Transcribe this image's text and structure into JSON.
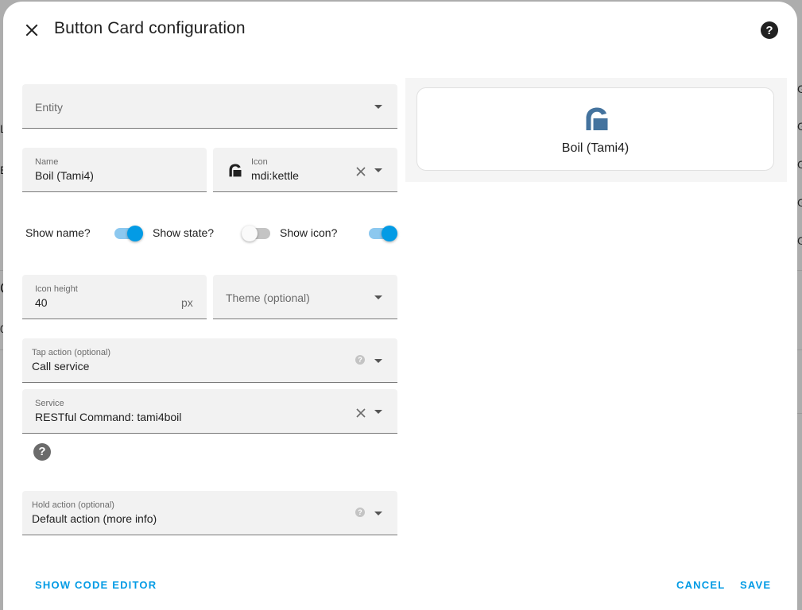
{
  "background": {
    "fragments": [
      "L",
      "E",
      "C",
      "0",
      "G",
      "G",
      "G",
      "G",
      "G"
    ]
  },
  "dialog": {
    "title": "Button Card configuration",
    "close_icon": "close-icon",
    "help_icon": "help-circle-icon"
  },
  "form": {
    "entity": {
      "label": "Entity"
    },
    "name": {
      "label": "Name",
      "value": "Boil (Tami4)"
    },
    "icon": {
      "label": "Icon",
      "value": "mdi:kettle",
      "glyph": "kettle-icon"
    },
    "toggles": {
      "show_name": {
        "label": "Show name?",
        "on": true
      },
      "show_state": {
        "label": "Show state?",
        "on": false
      },
      "show_icon": {
        "label": "Show icon?",
        "on": true
      }
    },
    "icon_height": {
      "label": "Icon height",
      "value": "40",
      "unit": "px"
    },
    "theme": {
      "label": "Theme (optional)"
    },
    "tap_action": {
      "label": "Tap action (optional)",
      "value": "Call service"
    },
    "service": {
      "label": "Service",
      "value": "RESTful Command: tami4boil"
    },
    "hold_action": {
      "label": "Hold action (optional)",
      "value": "Default action (more info)"
    }
  },
  "preview": {
    "name": "Boil (Tami4)",
    "icon": "kettle-icon",
    "icon_color": "#44739e"
  },
  "footer": {
    "show_code_editor": "SHOW CODE EDITOR",
    "cancel": "CANCEL",
    "save": "SAVE"
  },
  "colors": {
    "accent": "#039be5",
    "field_bg": "#f2f2f2"
  }
}
